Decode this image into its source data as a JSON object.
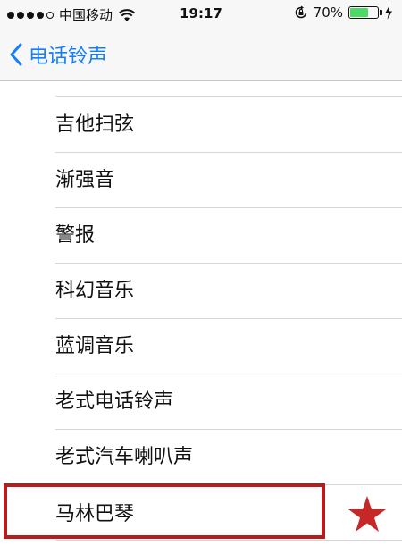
{
  "status_bar": {
    "carrier": "中国移动",
    "time": "19:17",
    "battery_percent_text": "70%",
    "battery_level": 0.7,
    "signal_bars_filled": 4,
    "signal_bars_total": 5
  },
  "nav": {
    "back_label": "电话铃声"
  },
  "ringtones": [
    {
      "label": "吉他扫弦"
    },
    {
      "label": "渐强音"
    },
    {
      "label": "警报"
    },
    {
      "label": "科幻音乐"
    },
    {
      "label": "蓝调音乐"
    },
    {
      "label": "老式电话铃声"
    },
    {
      "label": "老式汽车喇叭声"
    },
    {
      "label": "马林巴琴"
    }
  ],
  "highlighted_item": "马林巴琴",
  "colors": {
    "accent": "#157efb",
    "highlight_border": "#b71c1c",
    "star": "#c62828",
    "battery": "#4cd964"
  },
  "icons": [
    "chevron-left-icon",
    "wifi-icon",
    "rotation-lock-icon",
    "battery-icon",
    "charging-bolt-icon",
    "star-icon"
  ]
}
